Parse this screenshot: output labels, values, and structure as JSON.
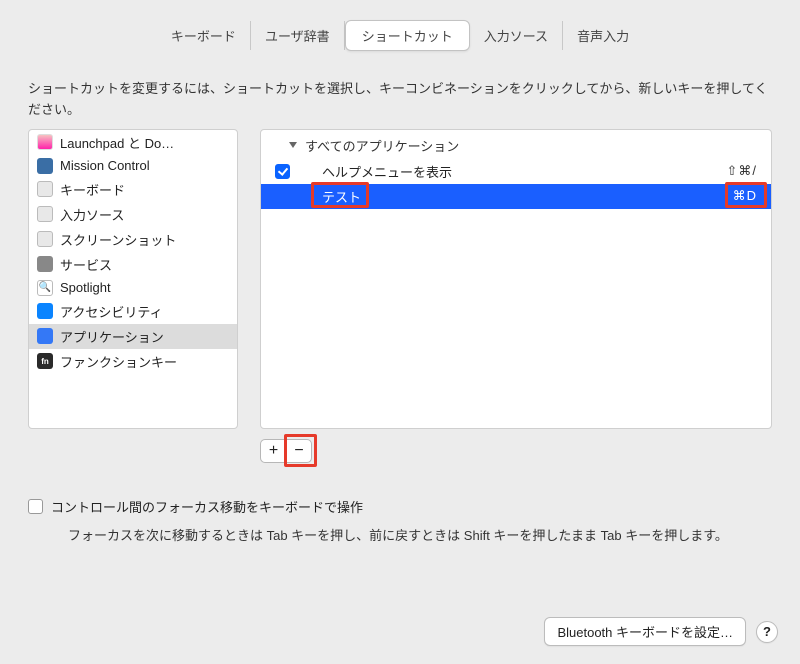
{
  "tabs": [
    {
      "label": "キーボード",
      "active": false
    },
    {
      "label": "ユーザ辞書",
      "active": false
    },
    {
      "label": "ショートカット",
      "active": true
    },
    {
      "label": "入力ソース",
      "active": false
    },
    {
      "label": "音声入力",
      "active": false
    }
  ],
  "instruction": "ショートカットを変更するには、ショートカットを選択し、キーコンビネーションをクリックしてから、新しいキーを押してください。",
  "sidebar": {
    "items": [
      {
        "label": "Launchpad と Do…",
        "icon": "launchpad"
      },
      {
        "label": "Mission Control",
        "icon": "mission"
      },
      {
        "label": "キーボード",
        "icon": "keyboard"
      },
      {
        "label": "入力ソース",
        "icon": "input"
      },
      {
        "label": "スクリーンショット",
        "icon": "screenshot"
      },
      {
        "label": "サービス",
        "icon": "services"
      },
      {
        "label": "Spotlight",
        "icon": "spotlight"
      },
      {
        "label": "アクセシビリティ",
        "icon": "accessibility"
      },
      {
        "label": "アプリケーション",
        "icon": "apps",
        "selected": true
      },
      {
        "label": "ファンクションキー",
        "icon": "fn",
        "glyph": "fn"
      }
    ]
  },
  "detail": {
    "group_header": "すべてのアプリケーション",
    "rows": [
      {
        "checked": true,
        "label": "ヘルプメニューを表示",
        "shortcut": "⇧⌘/",
        "selected": false
      },
      {
        "checked": true,
        "label": "テスト",
        "shortcut": "⌘D",
        "selected": true
      }
    ],
    "add_label": "+",
    "remove_label": "−"
  },
  "lower": {
    "checkbox_label": "コントロール間のフォーカス移動をキーボードで操作",
    "explain": "フォーカスを次に移動するときは Tab キーを押し、前に戻すときは Shift キーを押したまま Tab キーを押します。"
  },
  "footer": {
    "bluetooth_label": "Bluetooth キーボードを設定…",
    "help_label": "?"
  }
}
